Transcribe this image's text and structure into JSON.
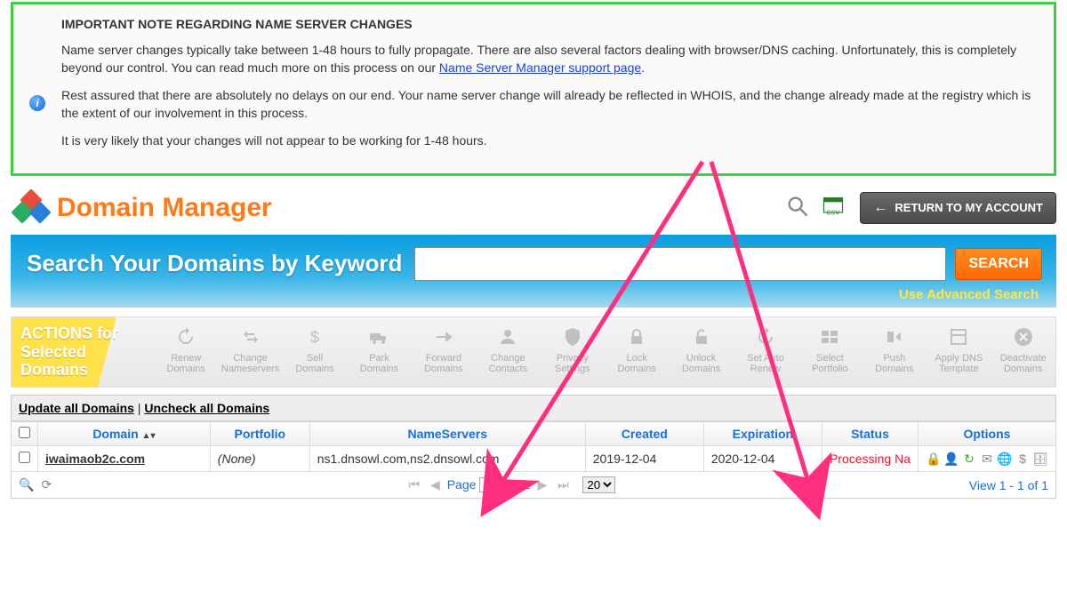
{
  "notice": {
    "title": "IMPORTANT NOTE REGARDING NAME SERVER CHANGES",
    "p1a": "Name server changes typically take between 1-48 hours to fully propagate. There are also several factors dealing with browser/DNS caching. Unfortunately, this is completely beyond our control. You can read much more on this process on our ",
    "link": "Name Server Manager support page",
    "p1b": ".",
    "p2": "Rest assured that there are absolutely no delays on our end. Your name server change will already be reflected in WHOIS, and the change already made at the registry which is the extent of our involvement in this process.",
    "p3": "It is very likely that your changes will not appear to be working for 1-48 hours."
  },
  "header": {
    "title": "Domain Manager",
    "return": "RETURN TO MY ACCOUNT"
  },
  "search": {
    "label": "Search Your Domains by Keyword",
    "placeholder": "",
    "button": "SEARCH",
    "advanced": "Use Advanced Search"
  },
  "actions": {
    "label1": "ACTIONS for",
    "label2": "Selected",
    "label3": "Domains",
    "items": [
      {
        "l1": "Renew",
        "l2": "Domains"
      },
      {
        "l1": "Change",
        "l2": "Nameservers"
      },
      {
        "l1": "Sell",
        "l2": "Domains"
      },
      {
        "l1": "Park",
        "l2": "Domains"
      },
      {
        "l1": "Forward",
        "l2": "Domains"
      },
      {
        "l1": "Change",
        "l2": "Contacts"
      },
      {
        "l1": "Privacy",
        "l2": "Settings"
      },
      {
        "l1": "Lock",
        "l2": "Domains"
      },
      {
        "l1": "Unlock",
        "l2": "Domains"
      },
      {
        "l1": "Set Auto",
        "l2": "Renew"
      },
      {
        "l1": "Select",
        "l2": "Portfolio"
      },
      {
        "l1": "Push",
        "l2": "Domains"
      },
      {
        "l1": "Apply DNS",
        "l2": "Template"
      },
      {
        "l1": "Deactivate",
        "l2": "Domains"
      }
    ]
  },
  "table": {
    "update_link": "Update all Domains",
    "sep": " | ",
    "uncheck_link": "Uncheck all Domains",
    "cols": {
      "domain": "Domain",
      "portfolio": "Portfolio",
      "nameservers": "NameServers",
      "created": "Created",
      "expiration": "Expiration",
      "status": "Status",
      "options": "Options"
    },
    "rows": [
      {
        "domain": "iwaimaob2c.com",
        "portfolio": "(None)",
        "nameservers": "ns1.dnsowl.com,ns2.dnsowl.com",
        "created": "2019-12-04",
        "expiration": "2020-12-04",
        "status": "Processing Na"
      }
    ]
  },
  "pager": {
    "page_lbl": "Page",
    "page_val": "1",
    "of_lbl": "of 1",
    "size": "20",
    "view": "View 1 - 1 of 1"
  }
}
